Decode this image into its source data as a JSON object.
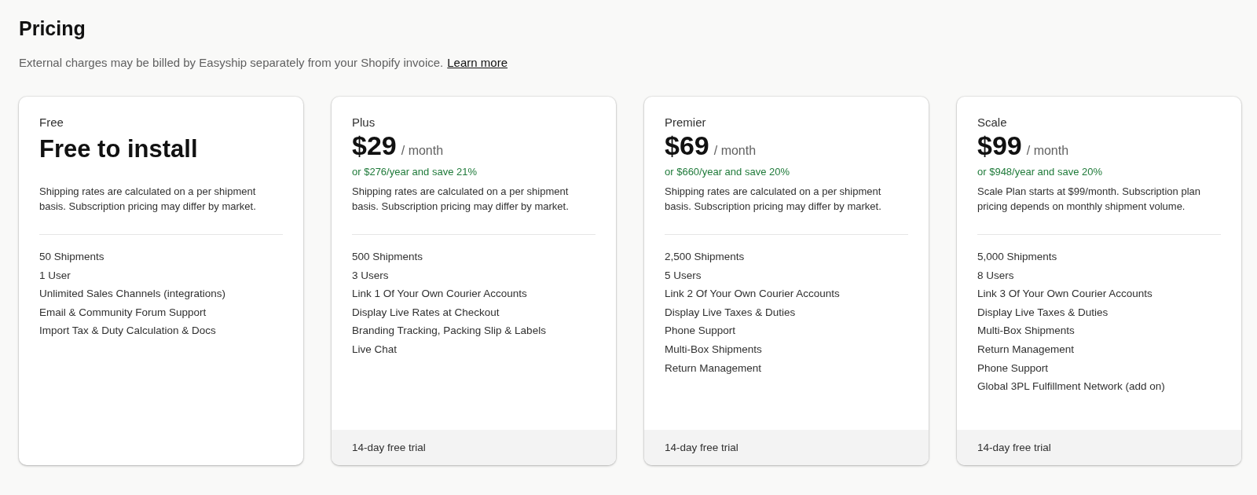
{
  "title": "Pricing",
  "subtitle": {
    "text": "External charges may be billed by Easyship separately from your Shopify invoice.",
    "link": "Learn more"
  },
  "plans": [
    {
      "kind": "free",
      "name": "Free",
      "price": "Free to install",
      "description": "Shipping rates are calculated on a per shipment basis. Subscription pricing may differ by market.",
      "features": [
        "50 Shipments",
        "1 User",
        "Unlimited Sales Channels (integrations)",
        "Email & Community Forum Support",
        "Import Tax & Duty Calculation & Docs"
      ]
    },
    {
      "kind": "paid",
      "name": "Plus",
      "price": "$29",
      "period": "/ month",
      "savings": "or $276/year and save 21%",
      "description": "Shipping rates are calculated on a per shipment basis. Subscription pricing may differ by market.",
      "features": [
        "500 Shipments",
        "3 Users",
        "Link 1 Of Your Own Courier Accounts",
        "Display Live Rates at Checkout",
        "Branding Tracking, Packing Slip & Labels",
        "Live Chat"
      ],
      "footer": "14-day free trial"
    },
    {
      "kind": "paid",
      "name": "Premier",
      "price": "$69",
      "period": "/ month",
      "savings": "or $660/year and save 20%",
      "description": "Shipping rates are calculated on a per shipment basis. Subscription pricing may differ by market.",
      "features": [
        "2,500 Shipments",
        "5 Users",
        "Link 2 Of Your Own Courier Accounts",
        "Display Live Taxes & Duties",
        "Phone Support",
        "Multi-Box Shipments",
        "Return Management"
      ],
      "footer": "14-day free trial"
    },
    {
      "kind": "paid",
      "name": "Scale",
      "price": "$99",
      "period": "/ month",
      "savings": "or $948/year and save 20%",
      "description": "Scale Plan starts at $99/month. Subscription plan pricing depends on monthly shipment volume.",
      "features": [
        "5,000 Shipments",
        "8 Users",
        "Link 3 Of Your Own Courier Accounts",
        "Display Live Taxes & Duties",
        "Multi-Box Shipments",
        "Return Management",
        "Phone Support",
        "Global 3PL Fulfillment Network (add on)"
      ],
      "footer": "14-day free trial"
    }
  ]
}
